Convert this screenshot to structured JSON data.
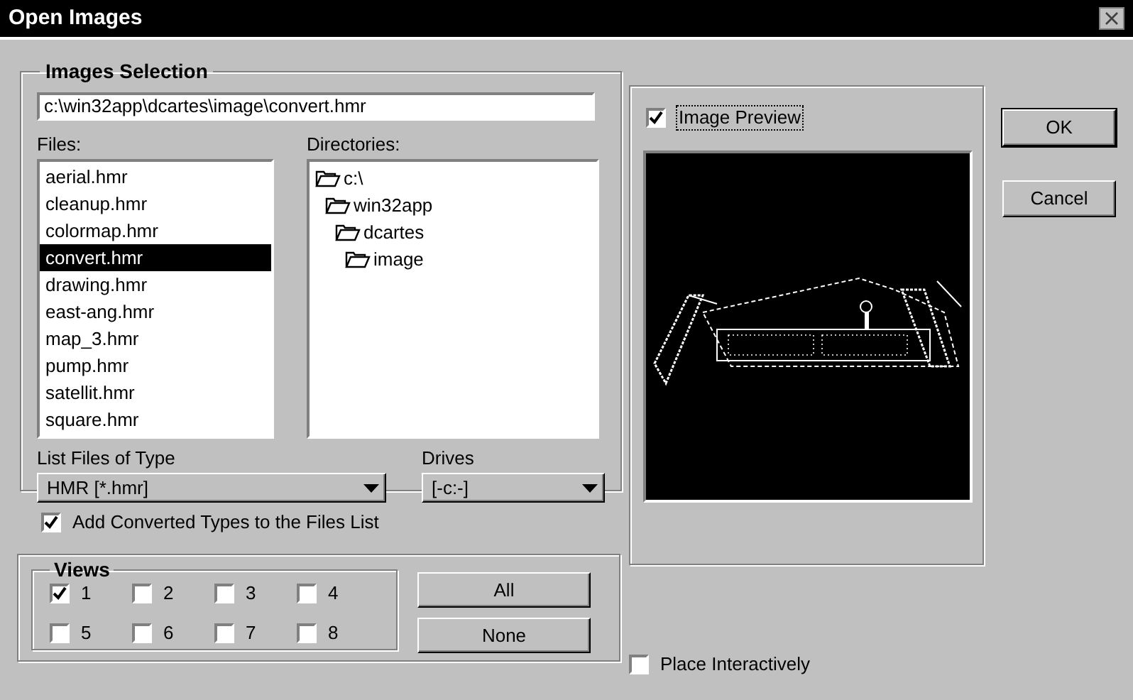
{
  "window": {
    "title": "Open Images"
  },
  "images_selection": {
    "legend": "Images Selection",
    "path": "c:\\win32app\\dcartes\\image\\convert.hmr",
    "files_label": "Files:",
    "files": [
      {
        "name": "aerial.hmr",
        "selected": false
      },
      {
        "name": "cleanup.hmr",
        "selected": false
      },
      {
        "name": "colormap.hmr",
        "selected": false
      },
      {
        "name": "convert.hmr",
        "selected": true
      },
      {
        "name": "drawing.hmr",
        "selected": false
      },
      {
        "name": "east-ang.hmr",
        "selected": false
      },
      {
        "name": "map_3.hmr",
        "selected": false
      },
      {
        "name": "pump.hmr",
        "selected": false
      },
      {
        "name": "satellit.hmr",
        "selected": false
      },
      {
        "name": "square.hmr",
        "selected": false
      }
    ],
    "directories_label": "Directories:",
    "directories": [
      {
        "name": "c:\\",
        "children": [
          {
            "name": "win32app",
            "children": [
              {
                "name": "dcartes",
                "children": [
                  {
                    "name": "image"
                  }
                ]
              }
            ]
          }
        ]
      }
    ],
    "file_type": {
      "label": "List Files of Type",
      "value": "HMR [*.hmr]"
    },
    "drives": {
      "label": "Drives",
      "value": "[-c:-]"
    },
    "add_converted": {
      "label": "Add Converted Types to the Files List",
      "checked": true
    }
  },
  "views": {
    "legend": "Views",
    "items": [
      {
        "label": "1",
        "checked": true
      },
      {
        "label": "2",
        "checked": false
      },
      {
        "label": "3",
        "checked": false
      },
      {
        "label": "4",
        "checked": false
      },
      {
        "label": "5",
        "checked": false
      },
      {
        "label": "6",
        "checked": false
      },
      {
        "label": "7",
        "checked": false
      },
      {
        "label": "8",
        "checked": false
      }
    ],
    "buttons": [
      "All",
      "None"
    ]
  },
  "preview": {
    "label": "Image Preview",
    "checked": true
  },
  "place_interactively": {
    "label": "Place Interactively",
    "checked": false
  },
  "buttons": [
    "OK",
    "Cancel"
  ]
}
